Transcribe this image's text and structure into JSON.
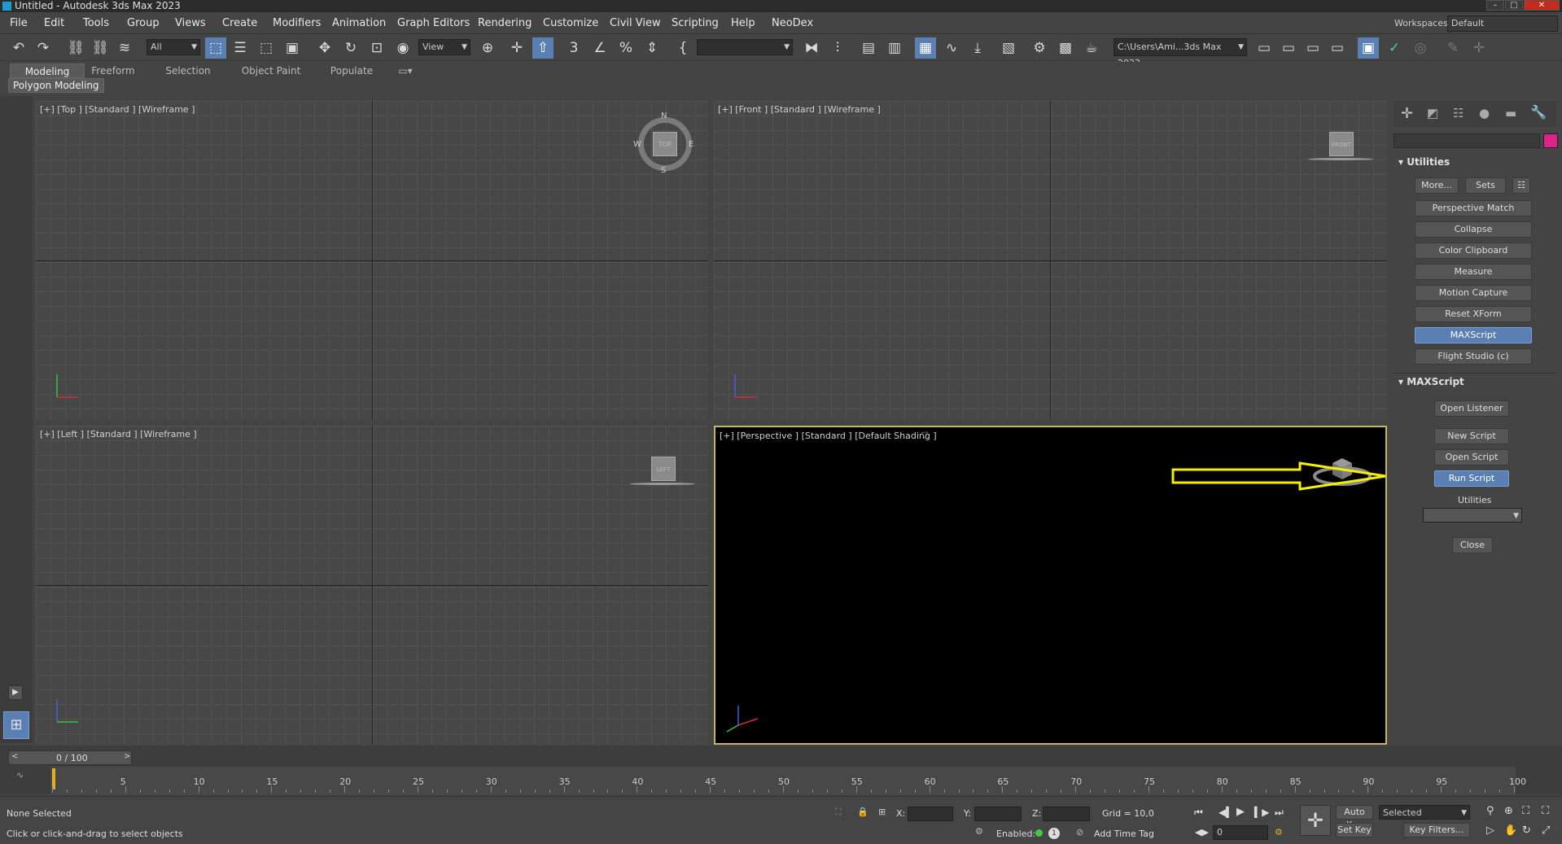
{
  "window": {
    "title": "Untitled - Autodesk 3ds Max 2023",
    "workspaces_label": "Workspaces:",
    "workspace_value": "Default"
  },
  "menu": [
    "File",
    "Edit",
    "Tools",
    "Group",
    "Views",
    "Create",
    "Modifiers",
    "Animation",
    "Graph Editors",
    "Rendering",
    "Customize",
    "Civil View",
    "Scripting",
    "Help",
    "NeoDex"
  ],
  "toolbar": {
    "selection_filter": "All",
    "ref_coord": "View",
    "project_path": "C:\\Users\\Ami...3ds Max 2023"
  },
  "ribbon": {
    "tabs": [
      "Modeling",
      "Freeform",
      "Selection",
      "Object Paint",
      "Populate"
    ],
    "active": "Modeling",
    "sub_panel": "Polygon Modeling"
  },
  "viewports": {
    "top": {
      "label": "[+] [Top ] [Standard ] [Wireframe ]",
      "cube": "TOP",
      "compass": [
        "N",
        "E",
        "S",
        "W"
      ]
    },
    "front": {
      "label": "[+] [Front ] [Standard ] [Wireframe ]",
      "cube": "FRONT"
    },
    "left": {
      "label": "[+] [Left ] [Standard ] [Wireframe ]",
      "cube": "LEFT"
    },
    "perspective": {
      "label": "[+] [Perspective ] [Standard ] [Default Shading ]"
    }
  },
  "command_panel": {
    "utilities_title": "Utilities",
    "top_buttons": {
      "more": "More...",
      "sets": "Sets"
    },
    "utility_buttons": [
      "Perspective Match",
      "Collapse",
      "Color Clipboard",
      "Measure",
      "Motion Capture",
      "Reset XForm",
      "MAXScript",
      "Flight Studio (c)"
    ],
    "active_utility": "MAXScript",
    "maxscript_title": "MAXScript",
    "maxscript_buttons": {
      "open_listener": "Open Listener",
      "new_script": "New Script",
      "open_script": "Open Script",
      "run_script": "Run Script"
    },
    "utilities_sub_label": "Utilities",
    "close": "Close"
  },
  "timeline": {
    "frame_display": "0 / 100",
    "ticks": [
      "5",
      "10",
      "15",
      "20",
      "25",
      "30",
      "35",
      "40",
      "45",
      "50",
      "55",
      "60",
      "65",
      "70",
      "75",
      "80",
      "85",
      "90",
      "95",
      "100"
    ]
  },
  "status": {
    "selection": "None Selected",
    "prompt": "Click or click-and-drag to select objects",
    "x_label": "X:",
    "y_label": "Y:",
    "z_label": "Z:",
    "grid": "Grid = 10,0",
    "enabled_label": "Enabled:",
    "add_time_tag": "Add Time Tag",
    "auto_key": "Auto Key",
    "set_key": "Set Key",
    "selected_value": "Selected",
    "key_filters": "Key Filters...",
    "current_frame": "0"
  },
  "colors": {
    "accent": "#5a7fb3",
    "arrow": "#f5f000",
    "perspective_border": "#c8b45a",
    "swatch": "#e0218a"
  }
}
